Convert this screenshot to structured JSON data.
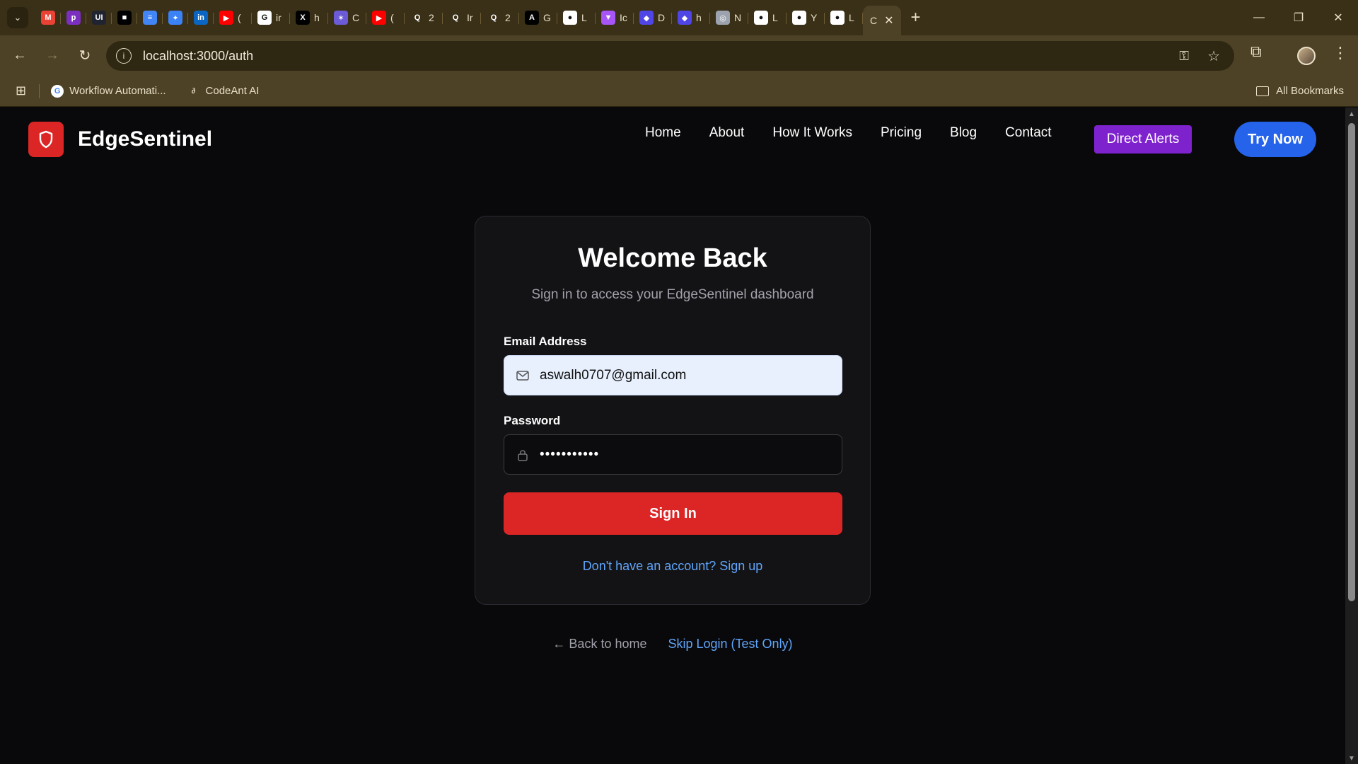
{
  "browser": {
    "tabs": [
      {
        "icon": "gmail-icon",
        "color": "#ea4335",
        "glyph": "M",
        "label": ""
      },
      {
        "icon": "p-app-icon",
        "color": "#7b2fbf",
        "glyph": "p",
        "label": ""
      },
      {
        "icon": "ui-app-icon",
        "color": "#1f2430",
        "glyph": "UI",
        "label": ""
      },
      {
        "icon": "square-app-icon",
        "color": "#000000",
        "glyph": "■",
        "label": ""
      },
      {
        "icon": "docs-icon",
        "color": "#4285f4",
        "glyph": "≡",
        "label": ""
      },
      {
        "icon": "gemini-icon",
        "color": "#3b82f6",
        "glyph": "✦",
        "label": ""
      },
      {
        "icon": "linkedin-icon",
        "color": "#0a66c2",
        "glyph": "in",
        "label": ""
      },
      {
        "icon": "youtube-icon",
        "color": "#ff0000",
        "glyph": "▶",
        "label": "("
      },
      {
        "icon": "google-icon",
        "color": "#ffffff",
        "glyph": "G",
        "label": "ir"
      },
      {
        "icon": "x-icon",
        "color": "#000000",
        "glyph": "X",
        "label": "h"
      },
      {
        "icon": "star-app-icon",
        "color": "#6b5bd6",
        "glyph": "✶",
        "label": "C"
      },
      {
        "icon": "youtube-icon",
        "color": "#ff0000",
        "glyph": "▶",
        "label": "("
      },
      {
        "icon": "search-app-icon",
        "color": "#3a3018",
        "glyph": "Q",
        "label": "2"
      },
      {
        "icon": "search-app-icon",
        "color": "#3a3018",
        "glyph": "Q",
        "label": "Ir"
      },
      {
        "icon": "search-app-icon",
        "color": "#3a3018",
        "glyph": "Q",
        "label": "2"
      },
      {
        "icon": "a-app-icon",
        "color": "#000000",
        "glyph": "A",
        "label": "G"
      },
      {
        "icon": "github-icon",
        "color": "#ffffff",
        "glyph": "●",
        "label": "L"
      },
      {
        "icon": "vite-icon",
        "color": "#a855f7",
        "glyph": "▼",
        "label": "Ic"
      },
      {
        "icon": "codeant-icon",
        "color": "#4f46e5",
        "glyph": "◆",
        "label": "D"
      },
      {
        "icon": "codeant-icon",
        "color": "#4f46e5",
        "glyph": "◆",
        "label": "h"
      },
      {
        "icon": "chrome-icon",
        "color": "#9ca3af",
        "glyph": "◎",
        "label": "N"
      },
      {
        "icon": "github-icon",
        "color": "#ffffff",
        "glyph": "●",
        "label": "L"
      },
      {
        "icon": "github-icon",
        "color": "#ffffff",
        "glyph": "●",
        "label": "Y"
      },
      {
        "icon": "github-icon",
        "color": "#ffffff",
        "glyph": "●",
        "label": "L"
      }
    ],
    "active_tab": {
      "label": "C",
      "close": "✕"
    },
    "new_tab": "+",
    "window_controls": {
      "minimize": "—",
      "restore": "❐",
      "close": "✕"
    },
    "url": "localhost:3000/auth",
    "bookmarks": [
      {
        "icon": "google-icon",
        "label": "Workflow Automati..."
      },
      {
        "icon": "codeant-icon",
        "label": "CodeAnt AI"
      }
    ],
    "all_bookmarks": "All Bookmarks"
  },
  "site": {
    "brand": "EdgeSentinel",
    "nav": [
      "Home",
      "About",
      "How It Works",
      "Pricing",
      "Blog",
      "Contact"
    ],
    "direct_alerts": "Direct Alerts",
    "try_now": "Try Now"
  },
  "auth": {
    "title": "Welcome Back",
    "subtitle": "Sign in to access your EdgeSentinel dashboard",
    "email_label": "Email Address",
    "email_value": "aswalh0707@gmail.com",
    "password_label": "Password",
    "password_value": "•••••••••••",
    "sign_in": "Sign In",
    "signup_link": "Don't have an account? Sign up",
    "back_home": "← Back to home",
    "skip_login": "Skip Login (Test Only)"
  },
  "colors": {
    "brand_red": "#dc2626",
    "alerts_purple": "#7e22ce",
    "try_blue": "#2563eb",
    "link_blue": "#60a5fa",
    "page_bg": "#09090b"
  }
}
